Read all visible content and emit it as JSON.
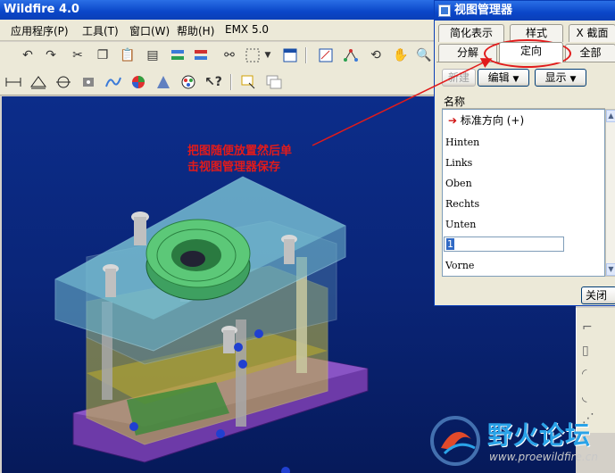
{
  "window": {
    "title": "Wildfire 4.0"
  },
  "menu": [
    "应用程序(P)",
    "工具(T)",
    "窗口(W)",
    "帮助(H)",
    "EMX 5.0"
  ],
  "toolbar_icons": {
    "row1": [
      "undo-icon",
      "redo-icon",
      "cut-icon",
      "copy-icon",
      "paste-icon",
      "paste-special-icon",
      "regenerate-icon",
      "regen-manager-icon",
      "find-icon",
      "select-box-icon",
      "dropdown-icon",
      "window-icon",
      "sketch-icon",
      "datum-icon",
      "spin-icon",
      "pan-icon",
      "zoom-icon"
    ],
    "row2": [
      "dimension-icon",
      "plane-icon",
      "axis-icon",
      "point-icon",
      "curve-icon",
      "appearance-icon",
      "analysis-icon",
      "color-icon",
      "help-cursor-icon",
      "note-icon",
      "note-stack-icon"
    ]
  },
  "annotation": {
    "line1": "把图随便放置然后单",
    "line2": "击视图管理器保存",
    "color": "#e11b1b"
  },
  "dialog": {
    "title": "视图管理器",
    "tabs_row1": [
      "简化表示",
      "样式",
      "X 截面"
    ],
    "tabs_row2": [
      "分解",
      "定向",
      "全部"
    ],
    "active_tab": "定向",
    "buttons": {
      "new": "新建",
      "edit": "编辑",
      "display": "显示"
    },
    "list_header": "名称",
    "items": [
      "标准方向 (+)",
      "Hinten",
      "Links",
      "Oben",
      "Rechts",
      "Unten"
    ],
    "edit_value": "1",
    "last_item": "Vorne",
    "close": "关闭"
  },
  "watermark": {
    "name": "野火论坛",
    "url": "www.proewildfire.cn"
  }
}
